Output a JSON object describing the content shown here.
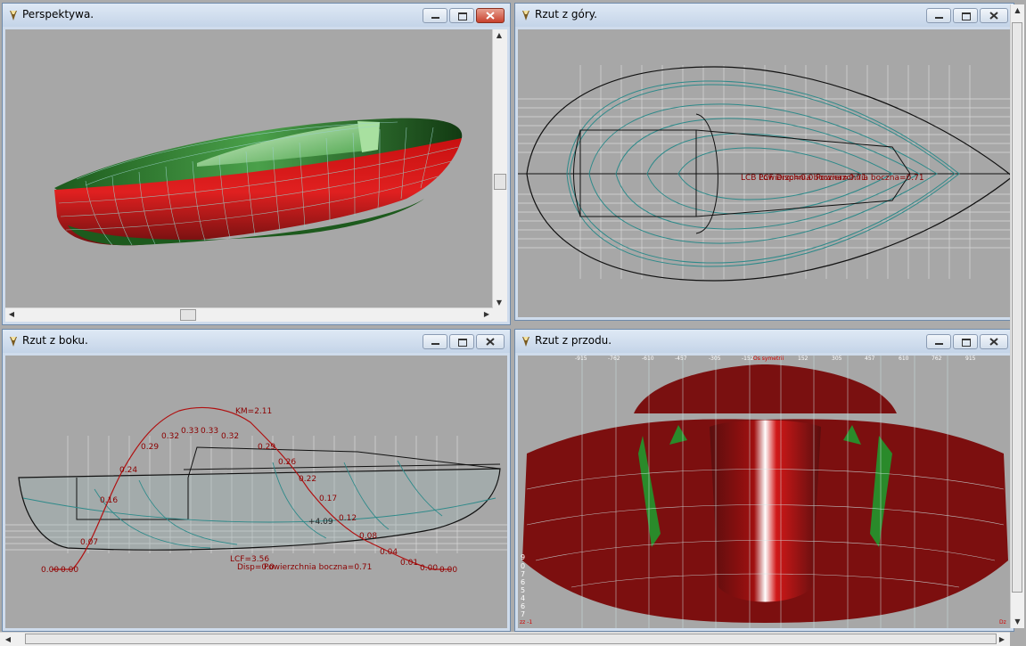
{
  "windows": {
    "perspective": {
      "title": "Perspektywa."
    },
    "top": {
      "title": "Rzut z góry."
    },
    "side": {
      "title": "Rzut z boku."
    },
    "front": {
      "title": "Rzut z przodu."
    }
  },
  "top_view": {
    "overlay_label": "LCB LCF Disp=0.0 Powierzchnia boczna=0.71",
    "overlay_tail": "Powierzchnia boczna=0.71"
  },
  "side_view": {
    "km_label": "KM=2.11",
    "kb_label": "+4.09",
    "lcf_label": "LCF=3.56",
    "disp_label": "Disp=0.0",
    "area_label": "Powierzchnia boczna=0.71",
    "curve_labels": [
      "0.00",
      "0.00",
      "0.07",
      "0.16",
      "0.24",
      "0.29",
      "0.32",
      "0.33",
      "0.33",
      "0.32",
      "0.29",
      "0.26",
      "0.22",
      "0.17",
      "0.12",
      "0.08",
      "0.04",
      "0.01",
      "0.00",
      "0.00"
    ]
  },
  "front_view": {
    "axis_ticks": [
      "-915",
      "-762",
      "-610",
      "-457",
      "-305",
      "-152",
      "Os symetrii",
      "152",
      "305",
      "457",
      "610",
      "762",
      "915"
    ],
    "waterline_ticks": [
      "9",
      "0",
      "7",
      "6",
      "5",
      "4",
      "6",
      "7"
    ],
    "corner_left": "zz -1",
    "corner_right": "Dz"
  },
  "colors": {
    "hull_red": "#d01010",
    "hull_green": "#1e6a1e",
    "window_frame": "#cfdcec",
    "viewport_bg": "#a7a7a7"
  }
}
